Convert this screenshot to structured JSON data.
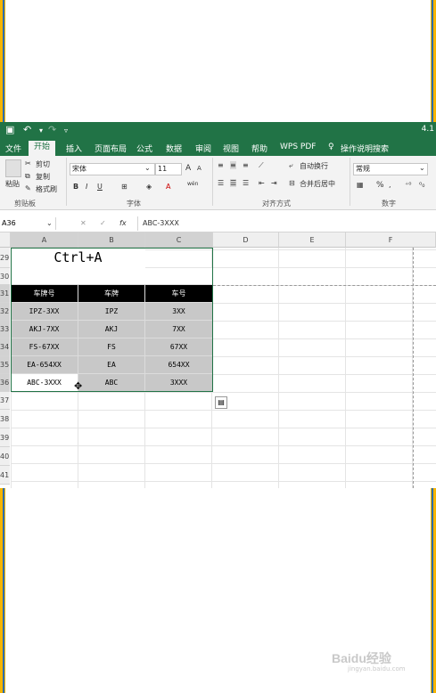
{
  "window": {
    "version": "4.1"
  },
  "tabs": [
    "文件",
    "开始",
    "插入",
    "页面布局",
    "公式",
    "数据",
    "审阅",
    "视图",
    "帮助",
    "WPS PDF",
    "操作说明搜索"
  ],
  "ribbon": {
    "clipboard": {
      "paste": "粘贴",
      "cut": "剪切",
      "copy": "复制",
      "format_painter": "格式刷",
      "group": "剪贴板"
    },
    "font": {
      "name": "宋体",
      "size": "11",
      "bold": "B",
      "italic": "I",
      "underline": "U",
      "grow": "A",
      "shrink": "A",
      "wen": "wén",
      "group": "字体"
    },
    "alignment": {
      "wrap": "自动换行",
      "merge": "合并后居中",
      "group": "对齐方式"
    },
    "number": {
      "format": "常规",
      "percent": "%",
      "group": "数字"
    }
  },
  "formula_bar": {
    "name_box": "A36",
    "fx": "fx",
    "cancel": "✕",
    "enter": "✓",
    "value": "ABC-3XXX"
  },
  "columns": [
    "A",
    "B",
    "C",
    "D",
    "E",
    "F"
  ],
  "rows": [
    "29",
    "30",
    "31",
    "32",
    "33",
    "34",
    "35",
    "36",
    "37",
    "38",
    "39",
    "40",
    "41"
  ],
  "annotation": "Ctrl+A",
  "table": {
    "headers": [
      "车牌号",
      "车牌",
      "车号"
    ],
    "rows": [
      [
        "IPZ-3XX",
        "IPZ",
        "3XX"
      ],
      [
        "AKJ-7XX",
        "AKJ",
        "7XX"
      ],
      [
        "FS-67XX",
        "FS",
        "67XX"
      ],
      [
        "EA-654XX",
        "EA",
        "654XX"
      ],
      [
        "ABC-3XXX",
        "ABC",
        "3XXX"
      ]
    ]
  },
  "watermark": {
    "text": "Baidu经验",
    "sub": "jingyan.baidu.com"
  },
  "colors": {
    "excel_green": "#217346",
    "selection": "#c8c8c8",
    "header_black": "#000000"
  }
}
